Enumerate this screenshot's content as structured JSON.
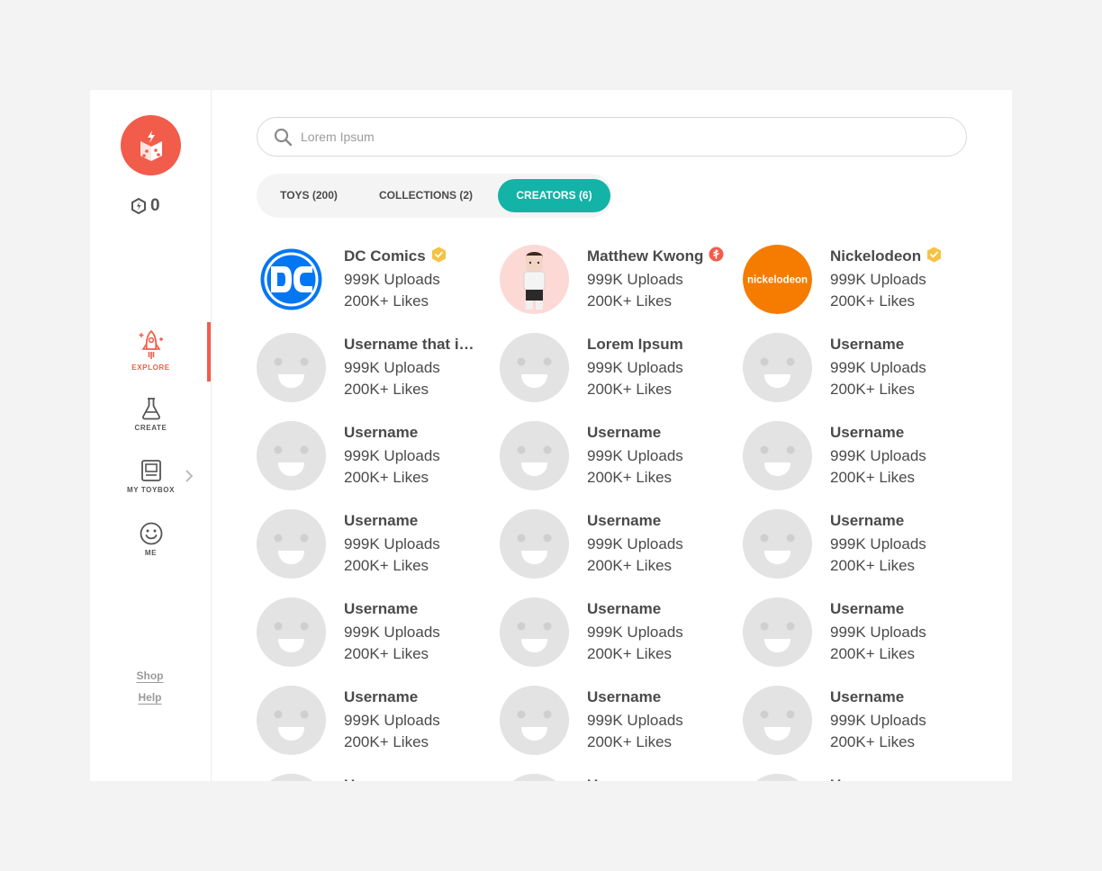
{
  "sidebar": {
    "logo_icon": "rocket-box-logo",
    "coins_icon": "hex-coin-icon",
    "coins": "0",
    "nav": [
      {
        "label": "EXPLORE",
        "icon": "rocket-icon",
        "active": true
      },
      {
        "label": "CREATE",
        "icon": "flask-icon",
        "active": false
      },
      {
        "label": "MY TOYBOX",
        "icon": "toybox-icon",
        "active": false
      },
      {
        "label": "ME",
        "icon": "smiley-icon",
        "active": false
      }
    ],
    "footer": {
      "shop": "Shop",
      "help": "Help"
    }
  },
  "search": {
    "placeholder": "Lorem Ipsum",
    "value": ""
  },
  "tabs": [
    {
      "label": "TOYS (200)",
      "active": false
    },
    {
      "label": "COLLECTIONS (2)",
      "active": false
    },
    {
      "label": "CREATORS (6)",
      "active": true
    }
  ],
  "colors": {
    "brand": "#f25c4b",
    "accent": "#14b3a7",
    "verified": "#f5c242",
    "placeholder_avatar": "#e3e3e3"
  },
  "creators": [
    {
      "name": "DC Comics",
      "uploads": "999K Uploads",
      "likes": "200K+ Likes",
      "avatar": "dc-logo",
      "badge": "verified-badge-icon"
    },
    {
      "name": "Matthew Kwong",
      "uploads": "999K Uploads",
      "likes": "200K+ Likes",
      "avatar": "person-avatar",
      "badge": "creator-badge-icon"
    },
    {
      "name": "Nickelodeon",
      "uploads": "999K Uploads",
      "likes": "200K+ Likes",
      "avatar": "nickelodeon-logo",
      "badge": "verified-badge-icon",
      "logo_text": "nickelodeon"
    },
    {
      "name": "Username that is very long",
      "uploads": "999K Uploads",
      "likes": "200K+ Likes",
      "avatar": "placeholder"
    },
    {
      "name": "Lorem Ipsum",
      "uploads": "999K Uploads",
      "likes": "200K+ Likes",
      "avatar": "placeholder"
    },
    {
      "name": "Username",
      "uploads": "999K Uploads",
      "likes": "200K+ Likes",
      "avatar": "placeholder"
    },
    {
      "name": "Username",
      "uploads": "999K Uploads",
      "likes": "200K+ Likes",
      "avatar": "placeholder"
    },
    {
      "name": "Username",
      "uploads": "999K Uploads",
      "likes": "200K+ Likes",
      "avatar": "placeholder"
    },
    {
      "name": "Username",
      "uploads": "999K Uploads",
      "likes": "200K+ Likes",
      "avatar": "placeholder"
    },
    {
      "name": "Username",
      "uploads": "999K Uploads",
      "likes": "200K+ Likes",
      "avatar": "placeholder"
    },
    {
      "name": "Username",
      "uploads": "999K Uploads",
      "likes": "200K+ Likes",
      "avatar": "placeholder"
    },
    {
      "name": "Username",
      "uploads": "999K Uploads",
      "likes": "200K+ Likes",
      "avatar": "placeholder"
    },
    {
      "name": "Username",
      "uploads": "999K Uploads",
      "likes": "200K+ Likes",
      "avatar": "placeholder"
    },
    {
      "name": "Username",
      "uploads": "999K Uploads",
      "likes": "200K+ Likes",
      "avatar": "placeholder"
    },
    {
      "name": "Username",
      "uploads": "999K Uploads",
      "likes": "200K+ Likes",
      "avatar": "placeholder"
    },
    {
      "name": "Username",
      "uploads": "999K Uploads",
      "likes": "200K+ Likes",
      "avatar": "placeholder"
    },
    {
      "name": "Username",
      "uploads": "999K Uploads",
      "likes": "200K+ Likes",
      "avatar": "placeholder"
    },
    {
      "name": "Username",
      "uploads": "999K Uploads",
      "likes": "200K+ Likes",
      "avatar": "placeholder"
    },
    {
      "name": "Username",
      "uploads": "",
      "likes": "",
      "avatar": "placeholder"
    },
    {
      "name": "Username",
      "uploads": "",
      "likes": "",
      "avatar": "placeholder"
    },
    {
      "name": "Username",
      "uploads": "",
      "likes": "",
      "avatar": "placeholder"
    }
  ]
}
